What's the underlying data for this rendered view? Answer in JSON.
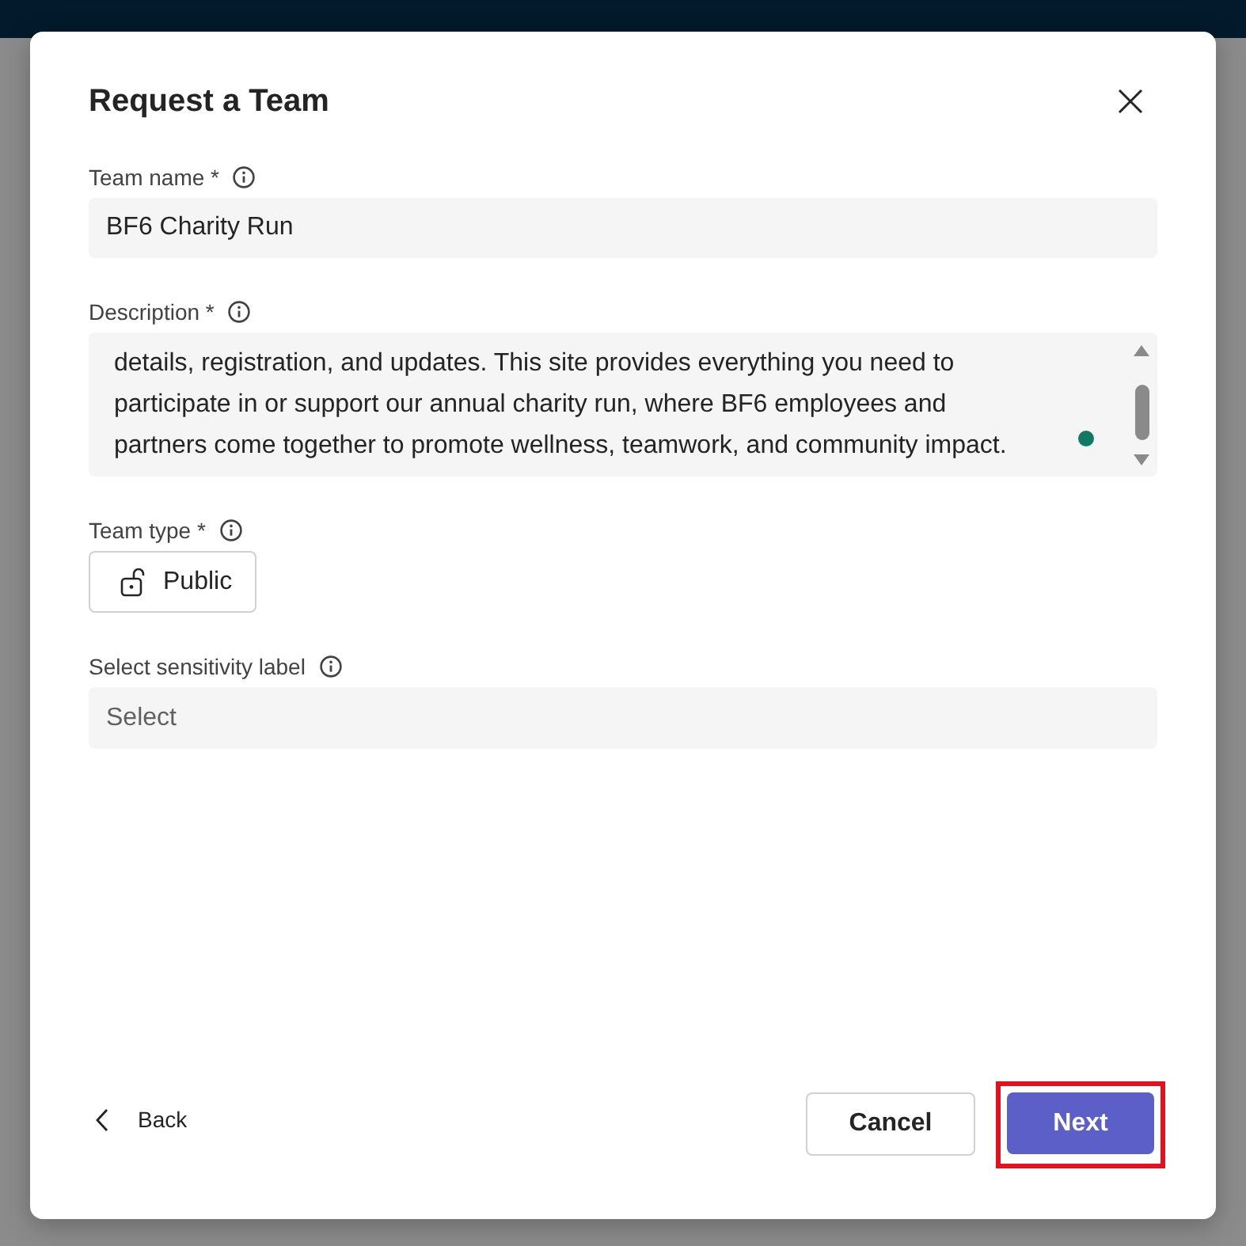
{
  "window": {
    "title": "Request a Team"
  },
  "form": {
    "fields": [
      {
        "kind": "text",
        "label": "Team name *",
        "value": "BF6 Charity Run"
      },
      {
        "kind": "textarea",
        "label": "Description *",
        "lines": [
          "details, registration, and updates. This site provides everything you need to",
          "participate in or support our annual charity run, where BF6 employees and",
          "partners come together to promote wellness, teamwork, and community impact."
        ]
      },
      {
        "kind": "choice",
        "label": "Team type *",
        "value": "Public"
      },
      {
        "kind": "select",
        "label": "Select sensitivity label",
        "placeholder": "Select"
      }
    ]
  },
  "footer": {
    "back": "Back",
    "buttons": [
      {
        "label": "Cancel",
        "kind": "secondary",
        "highlighted": false
      },
      {
        "label": "Next",
        "kind": "primary",
        "highlighted": true
      }
    ]
  }
}
